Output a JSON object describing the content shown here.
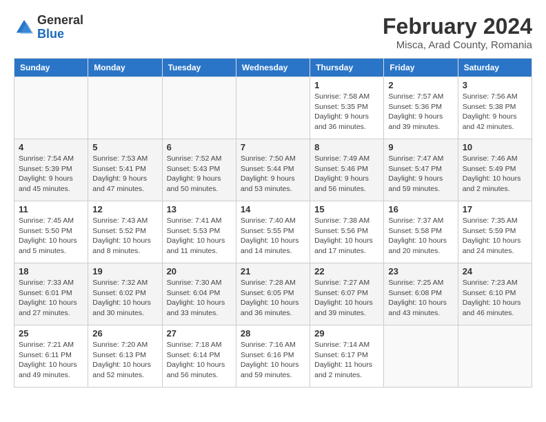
{
  "header": {
    "logo_general": "General",
    "logo_blue": "Blue",
    "month_year": "February 2024",
    "location": "Misca, Arad County, Romania"
  },
  "weekdays": [
    "Sunday",
    "Monday",
    "Tuesday",
    "Wednesday",
    "Thursday",
    "Friday",
    "Saturday"
  ],
  "weeks": [
    [
      {
        "day": "",
        "detail": ""
      },
      {
        "day": "",
        "detail": ""
      },
      {
        "day": "",
        "detail": ""
      },
      {
        "day": "",
        "detail": ""
      },
      {
        "day": "1",
        "detail": "Sunrise: 7:58 AM\nSunset: 5:35 PM\nDaylight: 9 hours\nand 36 minutes."
      },
      {
        "day": "2",
        "detail": "Sunrise: 7:57 AM\nSunset: 5:36 PM\nDaylight: 9 hours\nand 39 minutes."
      },
      {
        "day": "3",
        "detail": "Sunrise: 7:56 AM\nSunset: 5:38 PM\nDaylight: 9 hours\nand 42 minutes."
      }
    ],
    [
      {
        "day": "4",
        "detail": "Sunrise: 7:54 AM\nSunset: 5:39 PM\nDaylight: 9 hours\nand 45 minutes."
      },
      {
        "day": "5",
        "detail": "Sunrise: 7:53 AM\nSunset: 5:41 PM\nDaylight: 9 hours\nand 47 minutes."
      },
      {
        "day": "6",
        "detail": "Sunrise: 7:52 AM\nSunset: 5:43 PM\nDaylight: 9 hours\nand 50 minutes."
      },
      {
        "day": "7",
        "detail": "Sunrise: 7:50 AM\nSunset: 5:44 PM\nDaylight: 9 hours\nand 53 minutes."
      },
      {
        "day": "8",
        "detail": "Sunrise: 7:49 AM\nSunset: 5:46 PM\nDaylight: 9 hours\nand 56 minutes."
      },
      {
        "day": "9",
        "detail": "Sunrise: 7:47 AM\nSunset: 5:47 PM\nDaylight: 9 hours\nand 59 minutes."
      },
      {
        "day": "10",
        "detail": "Sunrise: 7:46 AM\nSunset: 5:49 PM\nDaylight: 10 hours\nand 2 minutes."
      }
    ],
    [
      {
        "day": "11",
        "detail": "Sunrise: 7:45 AM\nSunset: 5:50 PM\nDaylight: 10 hours\nand 5 minutes."
      },
      {
        "day": "12",
        "detail": "Sunrise: 7:43 AM\nSunset: 5:52 PM\nDaylight: 10 hours\nand 8 minutes."
      },
      {
        "day": "13",
        "detail": "Sunrise: 7:41 AM\nSunset: 5:53 PM\nDaylight: 10 hours\nand 11 minutes."
      },
      {
        "day": "14",
        "detail": "Sunrise: 7:40 AM\nSunset: 5:55 PM\nDaylight: 10 hours\nand 14 minutes."
      },
      {
        "day": "15",
        "detail": "Sunrise: 7:38 AM\nSunset: 5:56 PM\nDaylight: 10 hours\nand 17 minutes."
      },
      {
        "day": "16",
        "detail": "Sunrise: 7:37 AM\nSunset: 5:58 PM\nDaylight: 10 hours\nand 20 minutes."
      },
      {
        "day": "17",
        "detail": "Sunrise: 7:35 AM\nSunset: 5:59 PM\nDaylight: 10 hours\nand 24 minutes."
      }
    ],
    [
      {
        "day": "18",
        "detail": "Sunrise: 7:33 AM\nSunset: 6:01 PM\nDaylight: 10 hours\nand 27 minutes."
      },
      {
        "day": "19",
        "detail": "Sunrise: 7:32 AM\nSunset: 6:02 PM\nDaylight: 10 hours\nand 30 minutes."
      },
      {
        "day": "20",
        "detail": "Sunrise: 7:30 AM\nSunset: 6:04 PM\nDaylight: 10 hours\nand 33 minutes."
      },
      {
        "day": "21",
        "detail": "Sunrise: 7:28 AM\nSunset: 6:05 PM\nDaylight: 10 hours\nand 36 minutes."
      },
      {
        "day": "22",
        "detail": "Sunrise: 7:27 AM\nSunset: 6:07 PM\nDaylight: 10 hours\nand 39 minutes."
      },
      {
        "day": "23",
        "detail": "Sunrise: 7:25 AM\nSunset: 6:08 PM\nDaylight: 10 hours\nand 43 minutes."
      },
      {
        "day": "24",
        "detail": "Sunrise: 7:23 AM\nSunset: 6:10 PM\nDaylight: 10 hours\nand 46 minutes."
      }
    ],
    [
      {
        "day": "25",
        "detail": "Sunrise: 7:21 AM\nSunset: 6:11 PM\nDaylight: 10 hours\nand 49 minutes."
      },
      {
        "day": "26",
        "detail": "Sunrise: 7:20 AM\nSunset: 6:13 PM\nDaylight: 10 hours\nand 52 minutes."
      },
      {
        "day": "27",
        "detail": "Sunrise: 7:18 AM\nSunset: 6:14 PM\nDaylight: 10 hours\nand 56 minutes."
      },
      {
        "day": "28",
        "detail": "Sunrise: 7:16 AM\nSunset: 6:16 PM\nDaylight: 10 hours\nand 59 minutes."
      },
      {
        "day": "29",
        "detail": "Sunrise: 7:14 AM\nSunset: 6:17 PM\nDaylight: 11 hours\nand 2 minutes."
      },
      {
        "day": "",
        "detail": ""
      },
      {
        "day": "",
        "detail": ""
      }
    ]
  ]
}
